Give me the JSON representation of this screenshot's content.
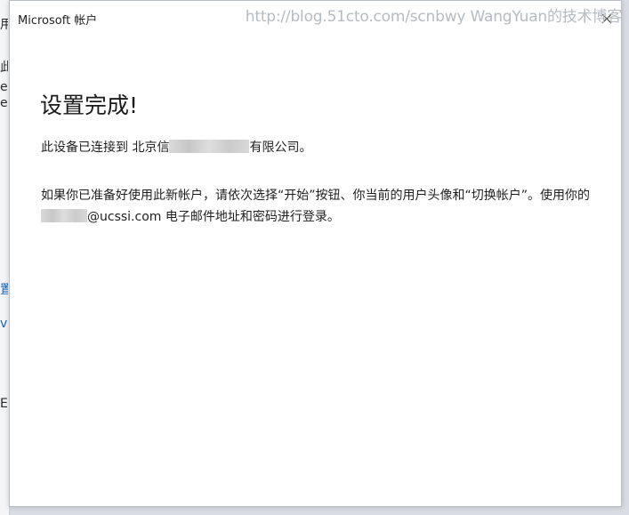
{
  "background_window": {
    "glyphs": [
      "用",
      "此",
      "e",
      "e",
      "置",
      "v",
      "E"
    ]
  },
  "dialog": {
    "title": "Microsoft 帐户",
    "close_icon": "close-icon",
    "heading": "设置完成!",
    "paragraph1": {
      "prefix": "此设备已连接到 北京",
      "visible_char": "信",
      "suffix": "有限公司。"
    },
    "paragraph2": {
      "line_text": "如果你已准备好使用此新帐户，请依次选择“开始”按钮、你当前的用户头像和“切换帐户”。使用你的",
      "email_domain": "@ucssi.com",
      "tail": " 电子邮件地址和密码进行登录。"
    }
  },
  "watermark": "http://blog.51cto.com/scnbwy WangYuan的技术博客",
  "colors": {
    "dialog_bg": "#ffffff",
    "desktop_bg": "#d9dde3",
    "text": "#1f1f1f",
    "watermark": "#b5bbc3"
  }
}
